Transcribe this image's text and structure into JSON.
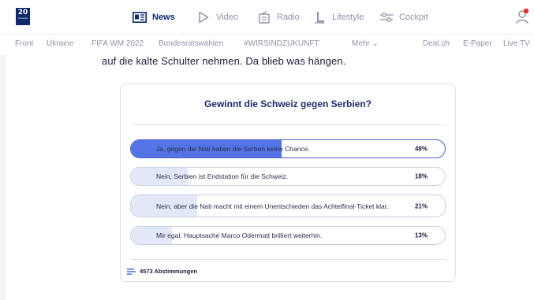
{
  "logo": {
    "text": "20",
    "sub": "minuten"
  },
  "nav": [
    {
      "label": "News",
      "icon": "news-icon",
      "active": true
    },
    {
      "label": "Video",
      "icon": "play-icon",
      "active": false
    },
    {
      "label": "Radio",
      "icon": "radio-icon",
      "active": false
    },
    {
      "label": "Lifestyle",
      "icon": "lifestyle-icon",
      "active": false
    },
    {
      "label": "Cockpit",
      "icon": "cockpit-icon",
      "active": false
    }
  ],
  "subnav": [
    "Front",
    "Ukraine",
    "FIFA WM 2022",
    "Bundesratswahlen",
    "#WIRSINDZUKUNFT",
    "Mehr ⌄",
    "Deal.ch",
    "E-Paper",
    "Live TV"
  ],
  "lead_text": "auf die kalte Schulter nehmen. Da blieb was hängen.",
  "poll": {
    "title": "Gewinnt die Schweiz gegen Serbien?",
    "options": [
      {
        "label": "Ja, gegen die Nati haben die Serben keine Chance.",
        "percent_label": "48%",
        "percent": 48,
        "selected": true
      },
      {
        "label": "Nein, Serbien ist Endstation für die Schweiz.",
        "percent_label": "18%",
        "percent": 18,
        "selected": false
      },
      {
        "label": "Nein, aber die Nati macht mit einem Unentschieden das Achtelfinal-Ticket klar.",
        "percent_label": "21%",
        "percent": 21,
        "selected": false
      },
      {
        "label": "Mir egal, Hauptsache Marco Odermatt brilliert weiterhin.",
        "percent_label": "13%",
        "percent": 13,
        "selected": false
      }
    ],
    "votes_label": "4573 Abstimmungen"
  },
  "colors": {
    "brand": "#0d2a6e",
    "accent": "#5474e6",
    "fill_light": "#e3e8f8",
    "alert": "#e8332a"
  }
}
